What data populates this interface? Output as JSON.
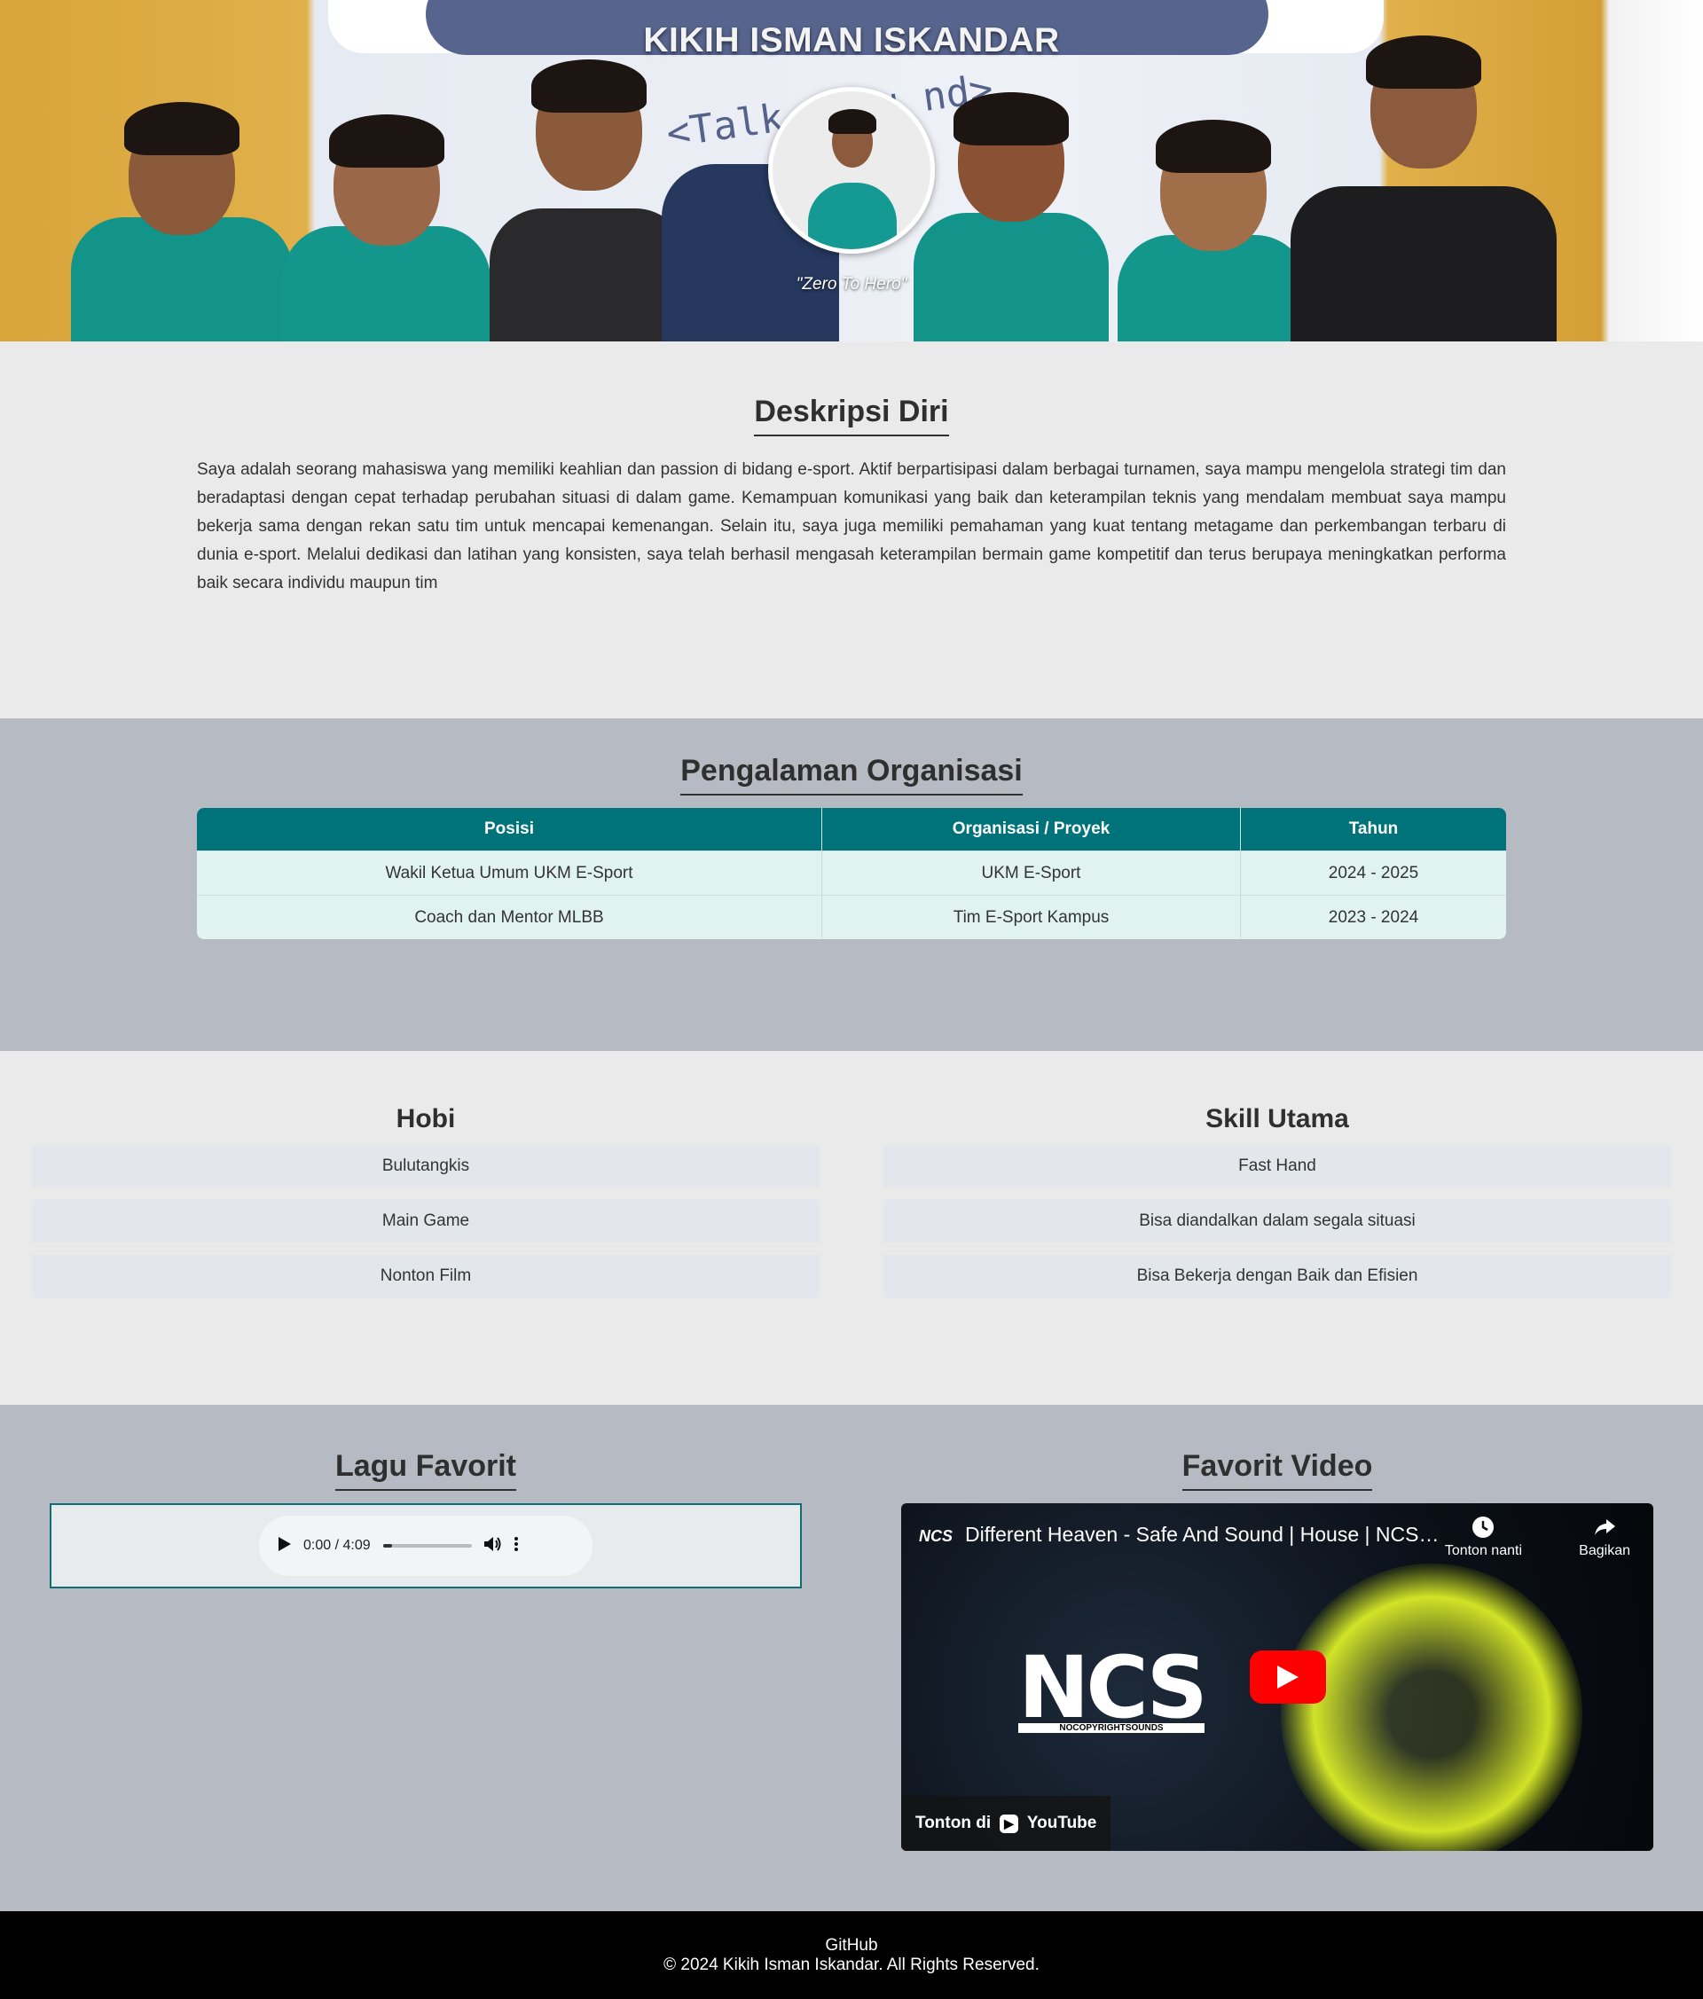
{
  "hero": {
    "title": "KIKIH ISMAN ISKANDAR",
    "quote": "\"Zero To Hero\"",
    "banner_text": "<Talk y          ou     nd>"
  },
  "description": {
    "heading": "Deskripsi Diri",
    "text": "Saya adalah seorang mahasiswa yang memiliki keahlian dan passion di bidang e-sport. Aktif berpartisipasi dalam berbagai turnamen, saya mampu mengelola strategi tim dan beradaptasi dengan cepat terhadap perubahan situasi di dalam game. Kemampuan komunikasi yang baik dan keterampilan teknis yang mendalam membuat saya mampu bekerja sama dengan rekan satu tim untuk mencapai kemenangan. Selain itu, saya juga memiliki pemahaman yang kuat tentang metagame dan perkembangan terbaru di dunia e-sport. Melalui dedikasi dan latihan yang konsisten, saya telah berhasil mengasah keterampilan bermain game kompetitif dan terus berupaya meningkatkan performa baik secara individu maupun tim"
  },
  "organization": {
    "heading": "Pengalaman Organisasi",
    "headers": [
      "Posisi",
      "Organisasi / Proyek",
      "Tahun"
    ],
    "rows": [
      [
        "Wakil Ketua Umum UKM E-Sport",
        "UKM E-Sport",
        "2024 - 2025"
      ],
      [
        "Coach dan Mentor MLBB",
        "Tim E-Sport Kampus",
        "2023 - 2024"
      ]
    ]
  },
  "hobbies": {
    "heading": "Hobi",
    "items": [
      "Bulutangkis",
      "Main Game",
      "Nonton Film"
    ]
  },
  "skills": {
    "heading": "Skill Utama",
    "items": [
      "Fast Hand",
      "Bisa diandalkan dalam segala situasi",
      "Bisa Bekerja dengan Baik dan Efisien"
    ]
  },
  "song": {
    "heading": "Lagu Favorit",
    "time": "0:00 / 4:09"
  },
  "video": {
    "heading": "Favorit Video",
    "channel": "NCS",
    "title": "Different Heaven - Safe And Sound | House | NCS - Copyright Free Music",
    "watch_later": "Tonton nanti",
    "share": "Bagikan",
    "watch_on": "Tonton di",
    "youtube": "YouTube",
    "thumb_logo": "NCS",
    "thumb_sub": "NOCOPYRIGHTSOUNDS"
  },
  "footer": {
    "link": "GitHub",
    "copyright": "© 2024 Kikih Isman Iskandar. All Rights Reserved."
  },
  "colors": {
    "table_header": "#00737a",
    "alt_section": "#b6bac3",
    "page_bg": "#eaeaea"
  }
}
